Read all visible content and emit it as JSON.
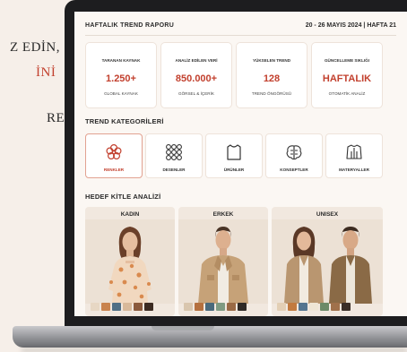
{
  "left_panel": {
    "line1": "Z EDİN,",
    "line2": "İNİ",
    "line3": "RE"
  },
  "header": {
    "title": "HAFTALIK TREND RAPORU",
    "date": "20 - 26 MAYIS 2024 | HAFTA 21"
  },
  "stats": [
    {
      "label": "TARANAN KAYNAK",
      "value": "1.250+",
      "sub": "GLOBAL KAYNAK"
    },
    {
      "label": "ANALİZ EDİLEN VERİ",
      "value": "850.000+",
      "sub": "GÖRSEL & İÇERİK"
    },
    {
      "label": "YÜKSELEN TREND",
      "value": "128",
      "sub": "TREND ÖNGÖRÜSÜ"
    },
    {
      "label": "GÜNCELLEME SIKLIĞI",
      "value": "HAFTALIK",
      "sub": "OTOMATİK ANALİZ"
    }
  ],
  "categories_title": "TREND KATEGORİLERİ",
  "categories": [
    {
      "label": "RENKLER",
      "icon": "flower-icon",
      "active": true
    },
    {
      "label": "DESENLER",
      "icon": "pattern-grid-icon",
      "active": false
    },
    {
      "label": "ÜRÜNLER",
      "icon": "shirt-icon",
      "active": false
    },
    {
      "label": "KONSEPTLER",
      "icon": "brain-icon",
      "active": false
    },
    {
      "label": "MATERYALLER",
      "icon": "jacket-icon",
      "active": false
    }
  ],
  "audience_title": "HEDEF KİTLE ANALİZİ",
  "audiences": [
    {
      "label": "KADIN",
      "swatches": [
        "#e7d7c4",
        "#c9834e",
        "#4f6f86",
        "#d8b99a",
        "#8b5a3c",
        "#3c2b22"
      ]
    },
    {
      "label": "ERKEK",
      "swatches": [
        "#d9c6ae",
        "#b5703e",
        "#4a6a7c",
        "#7f9b82",
        "#9a6a45",
        "#2f2a26"
      ]
    },
    {
      "label": "UNISEX",
      "swatches": [
        "#e3cfb5",
        "#c27a3f",
        "#557590",
        "#efe6d6",
        "#6d8a68",
        "#a0714b",
        "#3a2e27"
      ]
    }
  ],
  "colors": {
    "accent": "#c2402e",
    "text": "#2b2b2b"
  }
}
